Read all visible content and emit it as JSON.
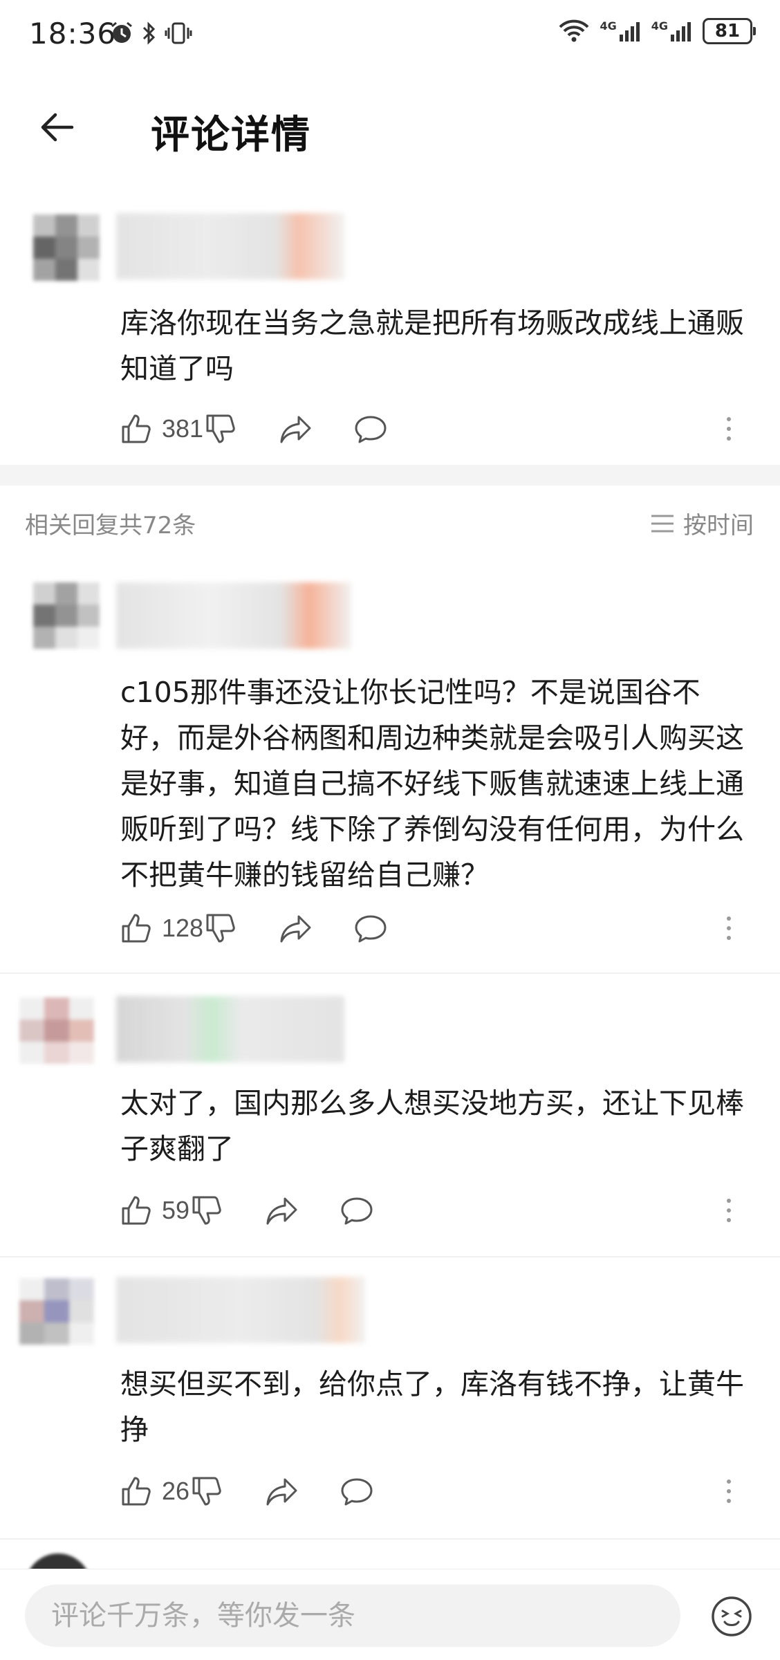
{
  "status_bar": {
    "time": "18:36",
    "battery": "81",
    "network_1": "4G",
    "network_2": "4G"
  },
  "header": {
    "title": "评论详情"
  },
  "main_comment": {
    "text": "库洛你现在当务之急就是把所有场贩改成线上通贩知道了吗",
    "likes": "381"
  },
  "replies_header": {
    "count_label": "相关回复共72条",
    "sort_label": "按时间"
  },
  "replies": [
    {
      "text": "c105那件事还没让你长记性吗？不是说国谷不好，而是外谷柄图和周边种类就是会吸引人购买这是好事，知道自己搞不好线下贩售就速速上线上通贩听到了吗？线下除了养倒勾没有任何用，为什么不把黄牛赚的钱留给自己赚？",
      "likes": "128"
    },
    {
      "text": "太对了，国内那么多人想买没地方买，还让下见棒子爽翻了",
      "likes": "59"
    },
    {
      "text": "想买但买不到，给你点了，库洛有钱不挣，让黄牛挣",
      "likes": "26"
    }
  ],
  "input": {
    "placeholder": "评论千万条，等你发一条"
  },
  "colors": {
    "text": "#1c1c1c",
    "muted": "#888888",
    "icon": "#555555",
    "divider": "#f4f4f4",
    "input_bg": "#f2f2f2"
  }
}
